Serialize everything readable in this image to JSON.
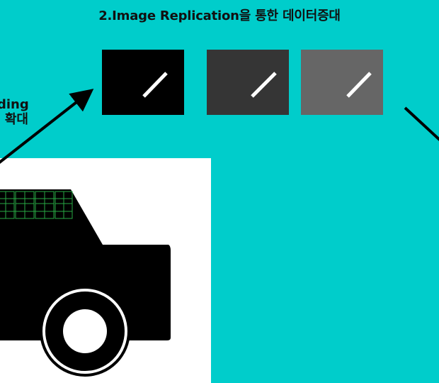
{
  "title": "2.Image Replication을 통한 데이터증대",
  "side_label": {
    "line1": "ding",
    "line2": "확대"
  },
  "replicated_tiles": [
    {
      "background": "#000000",
      "stroke": "#ffffff"
    },
    {
      "background": "#353535",
      "stroke": "#ffffff"
    },
    {
      "background": "#666666",
      "stroke": "#ffffff"
    }
  ],
  "colors": {
    "canvas": "#00cdcb",
    "arrow": "#000000",
    "grid": "#27a844"
  }
}
